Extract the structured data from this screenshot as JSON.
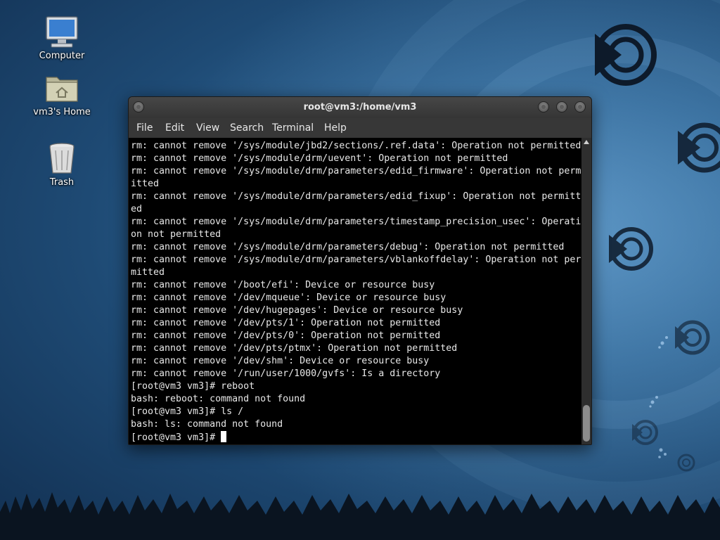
{
  "desktop": {
    "icons": [
      {
        "label": "Computer"
      },
      {
        "label": "vm3's Home"
      },
      {
        "label": "Trash"
      }
    ]
  },
  "terminal_window": {
    "title": "root@vm3:/home/vm3",
    "menu": [
      "File",
      "Edit",
      "View",
      "Search",
      "Terminal",
      "Help"
    ],
    "lines": [
      "rm: cannot remove '/sys/module/jbd2/sections/.ref.data': Operation not permitted",
      "rm: cannot remove '/sys/module/drm/uevent': Operation not permitted",
      "rm: cannot remove '/sys/module/drm/parameters/edid_firmware': Operation not perm",
      "itted",
      "rm: cannot remove '/sys/module/drm/parameters/edid_fixup': Operation not permitt",
      "ed",
      "rm: cannot remove '/sys/module/drm/parameters/timestamp_precision_usec': Operati",
      "on not permitted",
      "rm: cannot remove '/sys/module/drm/parameters/debug': Operation not permitted",
      "rm: cannot remove '/sys/module/drm/parameters/vblankoffdelay': Operation not per",
      "mitted",
      "rm: cannot remove '/boot/efi': Device or resource busy",
      "rm: cannot remove '/dev/mqueue': Device or resource busy",
      "rm: cannot remove '/dev/hugepages': Device or resource busy",
      "rm: cannot remove '/dev/pts/1': Operation not permitted",
      "rm: cannot remove '/dev/pts/0': Operation not permitted",
      "rm: cannot remove '/dev/pts/ptmx': Operation not permitted",
      "rm: cannot remove '/dev/shm': Device or resource busy",
      "rm: cannot remove '/run/user/1000/gvfs': Is a directory",
      "[root@vm3 vm3]# reboot",
      "bash: reboot: command not found",
      "[root@vm3 vm3]# ls /",
      "bash: ls: command not found"
    ],
    "prompt": "[root@vm3 vm3]# "
  },
  "colors": {
    "terminal_bg": "#000000",
    "terminal_fg": "#e8e8e8",
    "titlebar": "#3f3f3f",
    "desktop_bg": "#2f6696"
  }
}
